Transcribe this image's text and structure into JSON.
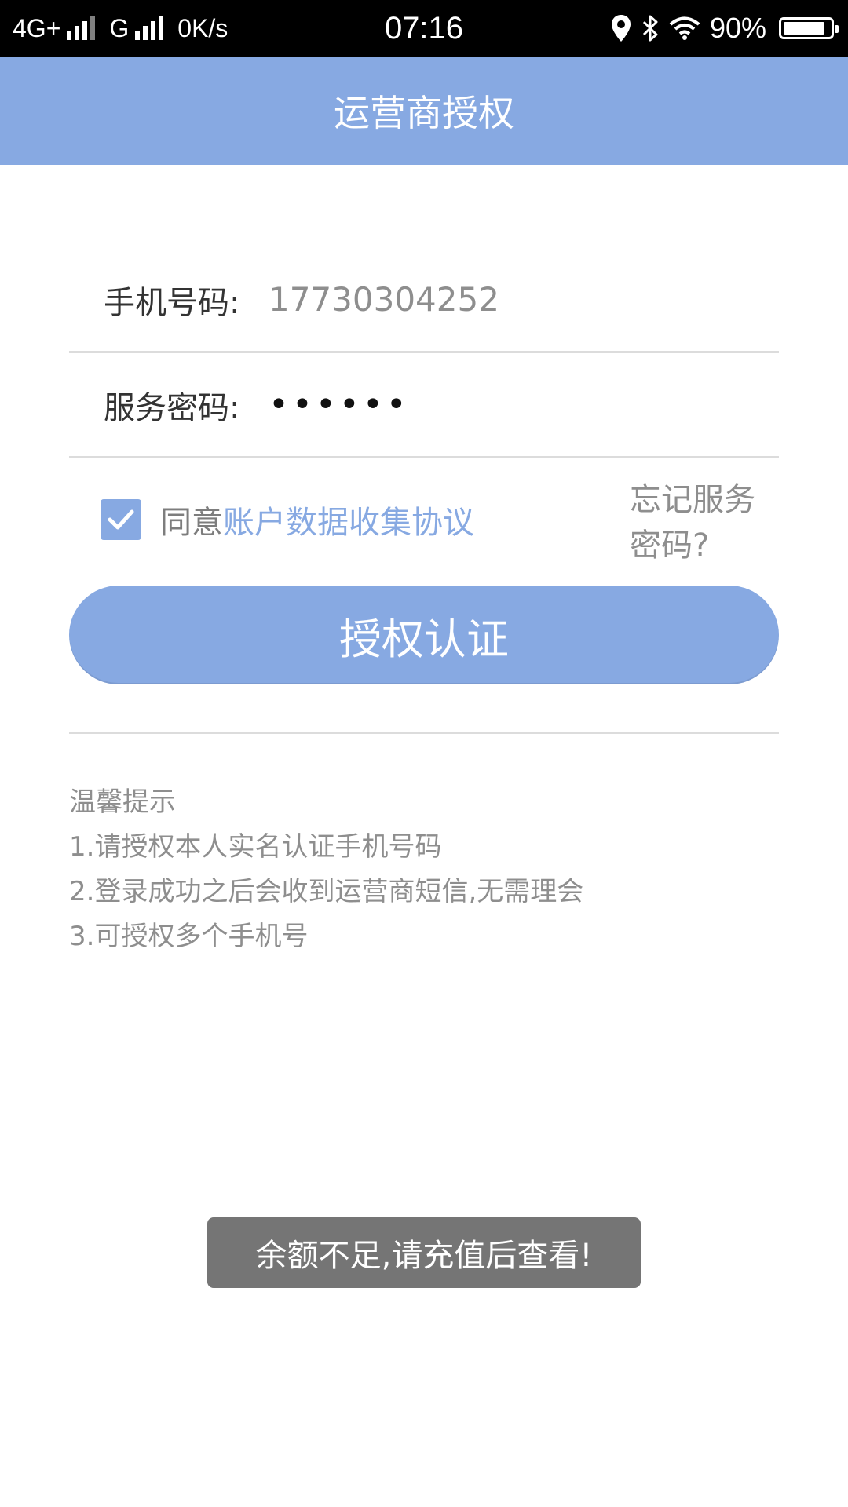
{
  "status_bar": {
    "network1": "4G+",
    "network2": "G",
    "speed": "0K/s",
    "time": "07:16",
    "battery": "90%",
    "battery_level": 0.9
  },
  "header": {
    "title": "运营商授权"
  },
  "form": {
    "phone_label": "手机号码:",
    "phone_value": "17730304252",
    "password_label": "服务密码:",
    "password_value": "••••••"
  },
  "agreement": {
    "checked": true,
    "prefix": "同意",
    "link": "账户数据收集协议",
    "forgot": "忘记服务密码?"
  },
  "auth_button": {
    "label": "授权认证"
  },
  "tips": {
    "title": "温馨提示",
    "items": [
      "1.请授权本人实名认证手机号码",
      "2.登录成功之后会收到运营商短信,无需理会",
      "3.可授权多个手机号"
    ]
  },
  "toast": {
    "message": "余额不足,请充值后查看!"
  },
  "colors": {
    "accent": "#87a9e2",
    "toast_bg": "#757575"
  }
}
